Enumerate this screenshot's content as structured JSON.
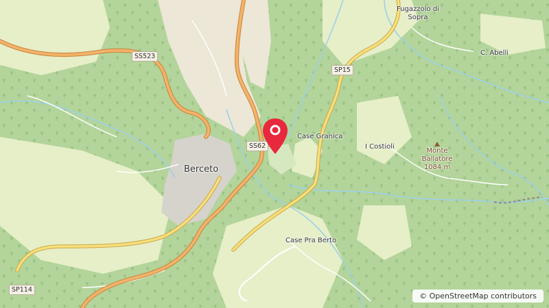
{
  "map": {
    "town": "Berceto",
    "places": {
      "fugazzolo": "Fugazzolo di\nSopra",
      "abelli": "C. Abelli",
      "granica": "Case Granica",
      "costioli": "I Costioli",
      "pra_berto": "Case Pra Berto"
    },
    "peak": {
      "name": "Monte\nBallatore",
      "elevation": "1084 m"
    },
    "roads": {
      "ss523": "SS523",
      "ss62": "SS62",
      "sp15": "SP15",
      "sp114": "SP114"
    },
    "marker": {
      "color": "#e8283c",
      "icon": "map-pin-icon"
    },
    "attribution": {
      "prefix": "©",
      "link_text": "OpenStreetMap contributors"
    },
    "colors": {
      "forest": "#b3d49a",
      "meadow": "#e6efc8",
      "urban": "#d6d2cc",
      "major_road": "#e8a45c",
      "secondary_road": "#f5e07a",
      "water": "#9ed0e8"
    }
  }
}
